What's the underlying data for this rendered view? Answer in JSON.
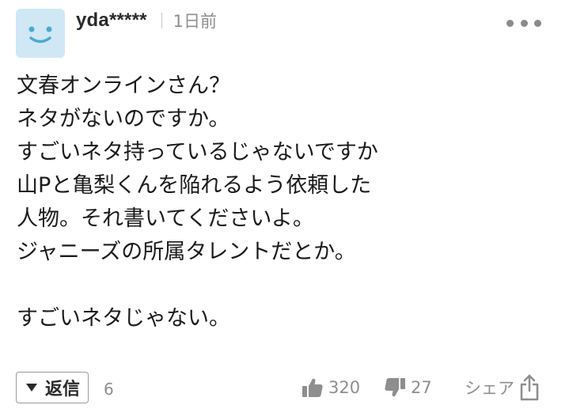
{
  "comment": {
    "username": "yda*****",
    "timestamp": "1日前",
    "icons": {
      "avatar": "smiley-face-avatar",
      "more": "more-dots-icon",
      "reply": "triangle-down-icon",
      "like": "thumbs-up-icon",
      "dislike": "thumbs-down-icon",
      "share": "share-icon"
    },
    "body_lines": [
      "文春オンラインさん？",
      "ネタがないのですか。",
      "すごいネタ持っているじゃないですか",
      "山Pと亀梨くんを陥れるよう依頼した",
      "人物。それ書いてくださいよ。",
      "ジャニーズの所属タレントだとか。",
      "",
      "すごいネタじゃない。"
    ],
    "reply": {
      "label": "返信",
      "count": "6"
    },
    "likes": "320",
    "dislikes": "27",
    "share_label": "シェア",
    "colors": {
      "avatar_bg": "#cfe8f4",
      "avatar_face": "#4ea8d2",
      "muted": "#8e8e8e",
      "text": "#1b1b1b"
    }
  }
}
